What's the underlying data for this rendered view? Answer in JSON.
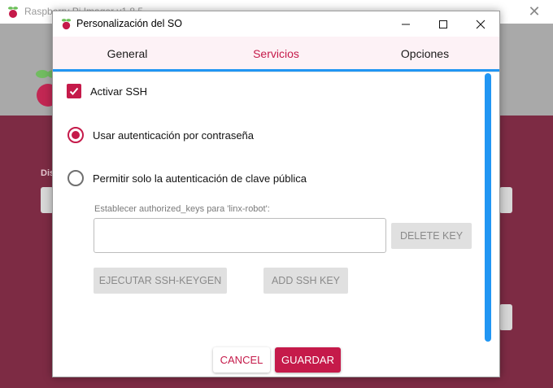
{
  "background_app": {
    "title": "Raspberry Pi Imager v1.8.5",
    "close_glyph": "✕",
    "partial_label": "Dis",
    "logo_icon": "raspberry-icon"
  },
  "dialog": {
    "title": "Personalización del SO",
    "title_icon": "raspberry-icon",
    "window_buttons": [
      "minimize-icon",
      "maximize-icon",
      "close-icon"
    ]
  },
  "tabs": [
    {
      "label": "General",
      "active": false
    },
    {
      "label": "Servicios",
      "active": true
    },
    {
      "label": "Opciones",
      "active": false
    }
  ],
  "ssh": {
    "enable_label": "Activar SSH",
    "enable_checked": true,
    "password_auth_label": "Usar autenticación por contraseña",
    "password_auth_selected": true,
    "pubkey_only_label": "Permitir solo la autenticación de clave pública",
    "pubkey_only_selected": false,
    "keys_label": "Establecer authorized_keys para 'linx-robot':",
    "keys_value": "",
    "delete_key_label": "DELETE KEY",
    "ssh_keygen_label": "EJECUTAR SSH-KEYGEN",
    "add_key_label": "ADD SSH KEY"
  },
  "footer": {
    "cancel_label": "CANCEL",
    "save_label": "GUARDAR"
  },
  "colors": {
    "accent": "#c51a4a",
    "scrollbar": "#2196f3",
    "background_red": "#7d2b44",
    "background_grey": "#a9a9a9"
  }
}
